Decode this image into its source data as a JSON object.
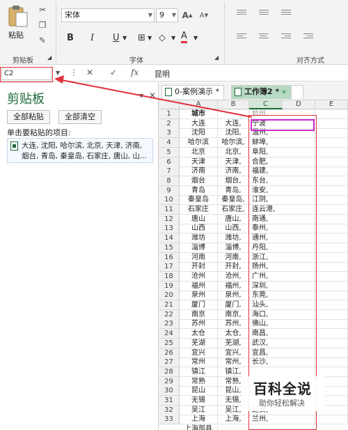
{
  "ribbon": {
    "clipboard_group": "剪贴板",
    "paste_label": "粘贴",
    "font_group": "字体",
    "align_group": "对齐方式",
    "font_name": "宋体",
    "font_size": "9",
    "bold": "B",
    "italic": "I",
    "underline": "U",
    "font_color_letter": "A"
  },
  "formula_bar": {
    "name_box": "C2",
    "value": "昆明"
  },
  "clipboard_pane": {
    "title": "剪贴板",
    "paste_all": "全部粘贴",
    "clear_all": "全部清空",
    "hint": "单击要粘贴的项目:",
    "item_line1": "大连, 沈阳, 哈尔滨, 北京, 天津, 济南,",
    "item_line2": "烟台, 青岛, 秦皇岛, 石家庄, 唐山, 山..."
  },
  "tabs": [
    {
      "label": "0-案例演示 *"
    },
    {
      "label": "工作簿2 *"
    }
  ],
  "columns": [
    "A",
    "B",
    "C",
    "D",
    "E"
  ],
  "row_numbers": [
    "1",
    "2",
    "3",
    "4",
    "5",
    "6",
    "7",
    "8",
    "9",
    "10",
    "11",
    "12",
    "13",
    "14",
    "15",
    "16",
    "17",
    "18",
    "19",
    "20",
    "21",
    "22",
    "23",
    "24",
    "25",
    "26",
    "27",
    "28",
    "29",
    "30",
    "31",
    "32",
    "33"
  ],
  "col_a": [
    "城市",
    "大连",
    "沈阳",
    "哈尔滨",
    "北京",
    "天津",
    "济南",
    "烟台",
    "青岛",
    "秦皇岛",
    "石家庄",
    "唐山",
    "山西",
    "潍坊",
    "淄博",
    "河南",
    "开封",
    "沧州",
    "福州",
    "泉州",
    "厦门",
    "南京",
    "苏州",
    "太仓",
    "芜湖",
    "宜兴",
    "常州",
    "镇江",
    "常熟",
    "昆山",
    "无锡",
    "吴江",
    "上海"
  ],
  "col_b": [
    "",
    "大连,",
    "沈阳,",
    "哈尔滨,",
    "北京,",
    "天津,",
    "济南,",
    "烟台,",
    "青岛,",
    "秦皇岛,",
    "石家庄,",
    "唐山,",
    "山西,",
    "潍坊,",
    "淄博,",
    "河南,",
    "开封,",
    "沧州,",
    "福州,",
    "泉州,",
    "厦门,",
    "南京,",
    "苏州,",
    "太仓,",
    "芜湖,",
    "宜兴,",
    "常州,",
    "镇江,",
    "常熟,",
    "昆山,",
    "无锡,",
    "吴江,",
    "上海,"
  ],
  "col_c": [
    "杭州,",
    "宁波",
    "温州,",
    "蚌埠,",
    "阜阳,",
    "合肥,",
    "福建,",
    "东台,",
    "淮安,",
    "江阴,",
    "连云港,",
    "南通,",
    "泰州,",
    "通州,",
    "丹阳,",
    "浙江,",
    "扬州,",
    "广州,",
    "深圳,",
    "东莞,",
    "汕头,",
    "海口,",
    "佛山,",
    "南昌,",
    "武汉,",
    "宜昌,",
    "长沙,",
    "",
    "",
    "",
    "",
    "延安,",
    "兰州,"
  ],
  "bottom_partial": "上海部县",
  "watermark": {
    "title": "百科全说",
    "subtitle": "助你轻松解决"
  },
  "colors": {
    "accent": "#1e6a3a",
    "annotation_red": "#e0303a",
    "annotation_magenta": "#d12ad1"
  }
}
